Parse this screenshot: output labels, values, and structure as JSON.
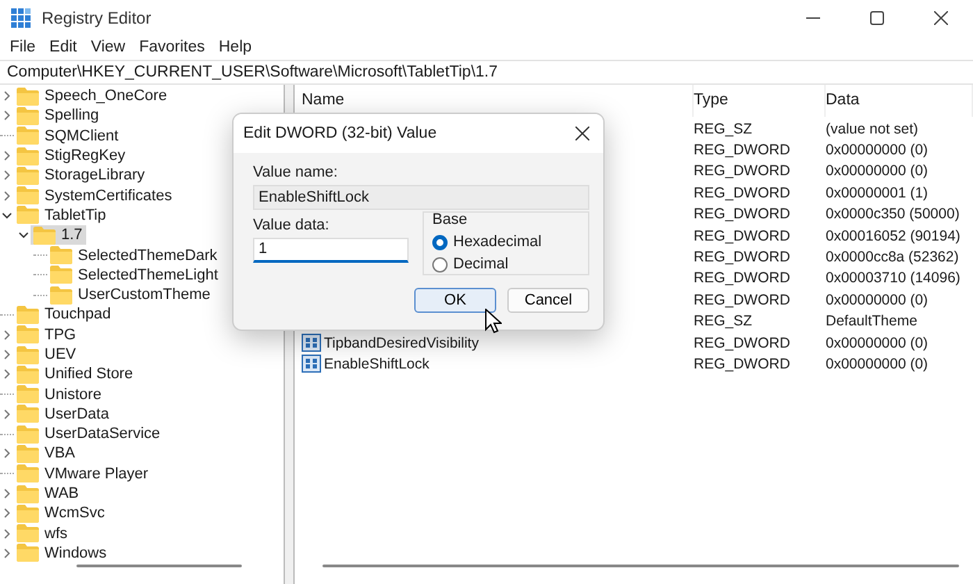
{
  "window": {
    "title": "Registry Editor"
  },
  "menu": [
    "File",
    "Edit",
    "View",
    "Favorites",
    "Help"
  ],
  "address": "Computer\\HKEY_CURRENT_USER\\Software\\Microsoft\\TabletTip\\1.7",
  "tree": [
    {
      "label": "Speech_OneCore",
      "expandable": true,
      "expanded": false,
      "selected": false
    },
    {
      "label": "Spelling",
      "expandable": true,
      "expanded": false,
      "selected": false
    },
    {
      "label": "SQMClient",
      "expandable": false,
      "selected": false
    },
    {
      "label": "StigRegKey",
      "expandable": true,
      "expanded": false,
      "selected": false
    },
    {
      "label": "StorageLibrary",
      "expandable": true,
      "expanded": false,
      "selected": false
    },
    {
      "label": "SystemCertificates",
      "expandable": true,
      "expanded": false,
      "selected": false
    },
    {
      "label": "TabletTip",
      "expandable": true,
      "expanded": true,
      "selected": false,
      "children": [
        {
          "label": "1.7",
          "expandable": true,
          "expanded": true,
          "selected": true,
          "children": [
            {
              "label": "SelectedThemeDark",
              "expandable": false,
              "selected": false
            },
            {
              "label": "SelectedThemeLight",
              "expandable": false,
              "selected": false
            },
            {
              "label": "UserCustomTheme",
              "expandable": false,
              "selected": false
            }
          ]
        }
      ]
    },
    {
      "label": "Touchpad",
      "expandable": false,
      "selected": false
    },
    {
      "label": "TPG",
      "expandable": true,
      "expanded": false,
      "selected": false
    },
    {
      "label": "UEV",
      "expandable": true,
      "expanded": false,
      "selected": false
    },
    {
      "label": "Unified Store",
      "expandable": true,
      "expanded": false,
      "selected": false
    },
    {
      "label": "Unistore",
      "expandable": false,
      "selected": false
    },
    {
      "label": "UserData",
      "expandable": true,
      "expanded": false,
      "selected": false
    },
    {
      "label": "UserDataService",
      "expandable": false,
      "selected": false
    },
    {
      "label": "VBA",
      "expandable": true,
      "expanded": false,
      "selected": false
    },
    {
      "label": "VMware Player",
      "expandable": false,
      "selected": false
    },
    {
      "label": "WAB",
      "expandable": true,
      "expanded": false,
      "selected": false
    },
    {
      "label": "WcmSvc",
      "expandable": true,
      "expanded": false,
      "selected": false
    },
    {
      "label": "wfs",
      "expandable": true,
      "expanded": false,
      "selected": false
    },
    {
      "label": "Windows",
      "expandable": true,
      "expanded": false,
      "selected": false
    }
  ],
  "values": {
    "columns": [
      "Name",
      "Type",
      "Data"
    ],
    "rows": [
      {
        "type": "REG_SZ",
        "data": "(value not set)"
      },
      {
        "type": "REG_DWORD",
        "data": "0x00000000 (0)"
      },
      {
        "type": "REG_DWORD",
        "data": "0x00000000 (0)"
      },
      {
        "type": "REG_DWORD",
        "data": "0x00000001 (1)"
      },
      {
        "type": "REG_DWORD",
        "data": "0x0000c350 (50000)"
      },
      {
        "type": "REG_DWORD",
        "data": "0x00016052 (90194)"
      },
      {
        "type": "REG_DWORD",
        "data": "0x0000cc8a (52362)"
      },
      {
        "type": "REG_DWORD",
        "data": "0x00003710 (14096)"
      },
      {
        "type": "REG_DWORD",
        "data": "0x00000000 (0)"
      },
      {
        "type": "REG_SZ",
        "data": "DefaultTheme"
      },
      {
        "name": "TipbandDesiredVisibility",
        "type": "REG_DWORD",
        "data": "0x00000000 (0)"
      },
      {
        "name": "EnableShiftLock",
        "type": "REG_DWORD",
        "data": "0x00000000 (0)"
      }
    ]
  },
  "dialog": {
    "title": "Edit DWORD (32-bit) Value",
    "name_label": "Value name:",
    "name_value": "EnableShiftLock",
    "data_label": "Value data:",
    "data_value": "1",
    "base_label": "Base",
    "base_options": [
      {
        "label": "Hexadecimal",
        "selected": true
      },
      {
        "label": "Decimal",
        "selected": false
      }
    ],
    "buttons": [
      {
        "label": "OK",
        "focused": true
      },
      {
        "label": "Cancel",
        "focused": false
      }
    ]
  }
}
